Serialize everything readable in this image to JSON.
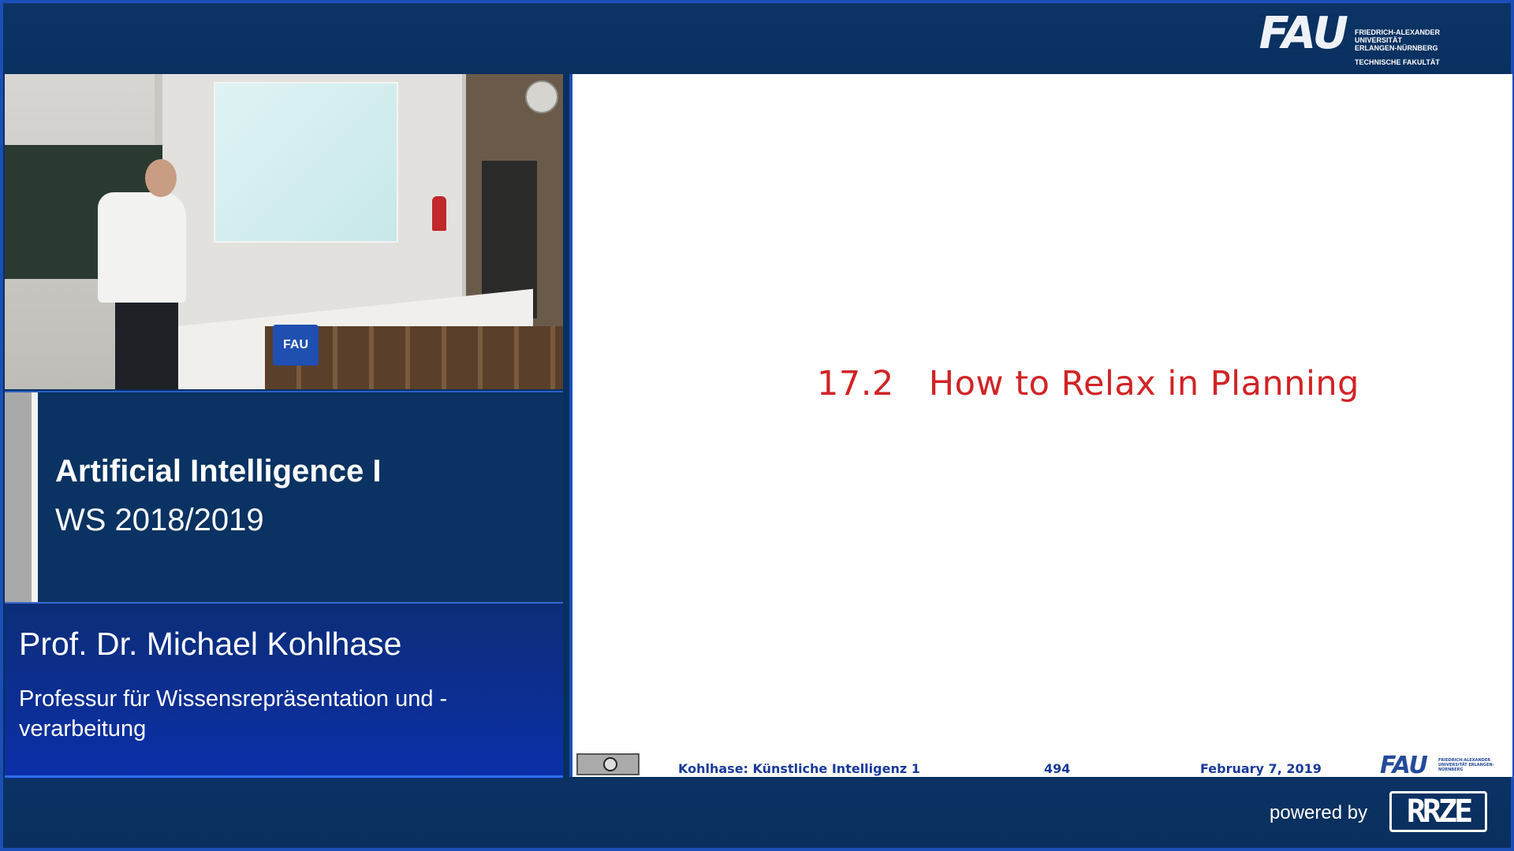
{
  "header": {
    "logo_mark": "FAU",
    "logo_lines": [
      "FRIEDRICH-ALEXANDER",
      "UNIVERSITÄT",
      "ERLANGEN-NÜRNBERG"
    ],
    "logo_faculty": "TECHNISCHE FAKULTÄT"
  },
  "video": {
    "cube_label": "FAU"
  },
  "course": {
    "title": "Artificial Intelligence I",
    "term": "WS 2018/2019"
  },
  "presenter": {
    "name": "Prof. Dr. Michael Kohlhase",
    "chair": "Professur für Wissensrepräsentation und -verarbeitung"
  },
  "slide": {
    "section_number": "17.2",
    "section_title": "How to Relax in Planning",
    "footer": {
      "author": "Kohlhase: Künstliche Intelligenz 1",
      "page": "494",
      "date": "February 7, 2019",
      "logo": "FAU",
      "logo_small": "FRIEDRICH-ALEXANDER UNIVERSITÄT ERLANGEN-NÜRNBERG"
    }
  },
  "footer_bar": {
    "powered_by": "powered by",
    "rrze_logo": "RRZE"
  },
  "colors": {
    "brand_blue": "#0a3060",
    "accent_blue": "#1b4fb8",
    "heading_red": "#d22326"
  }
}
